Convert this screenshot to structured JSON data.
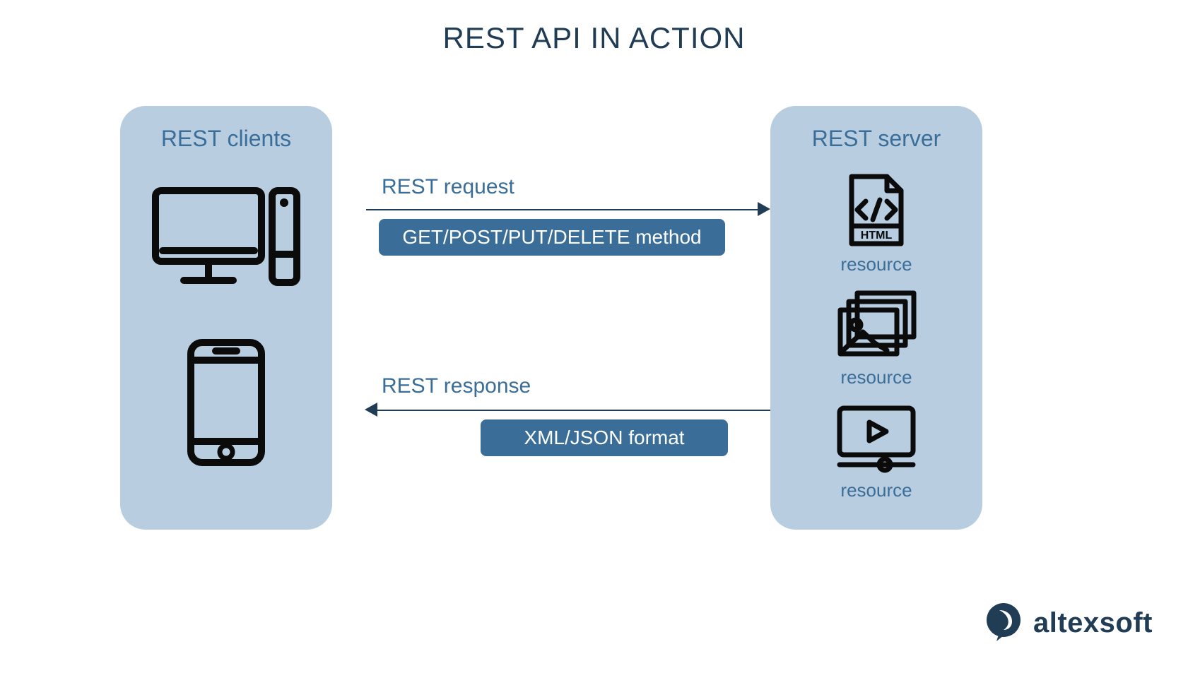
{
  "title": "REST API IN ACTION",
  "client_panel": {
    "title": "REST clients"
  },
  "server_panel": {
    "title": "REST server",
    "resources": [
      {
        "label": "resource"
      },
      {
        "label": "resource"
      },
      {
        "label": "resource"
      }
    ]
  },
  "request": {
    "label": "REST request",
    "badge": "GET/POST/PUT/DELETE method"
  },
  "response": {
    "label": "REST response",
    "badge": "XML/JSON format"
  },
  "brand": {
    "name": "altexsoft"
  },
  "colors": {
    "panel": "#b8cde0",
    "accent": "#3a6e99",
    "text": "#213c55"
  }
}
